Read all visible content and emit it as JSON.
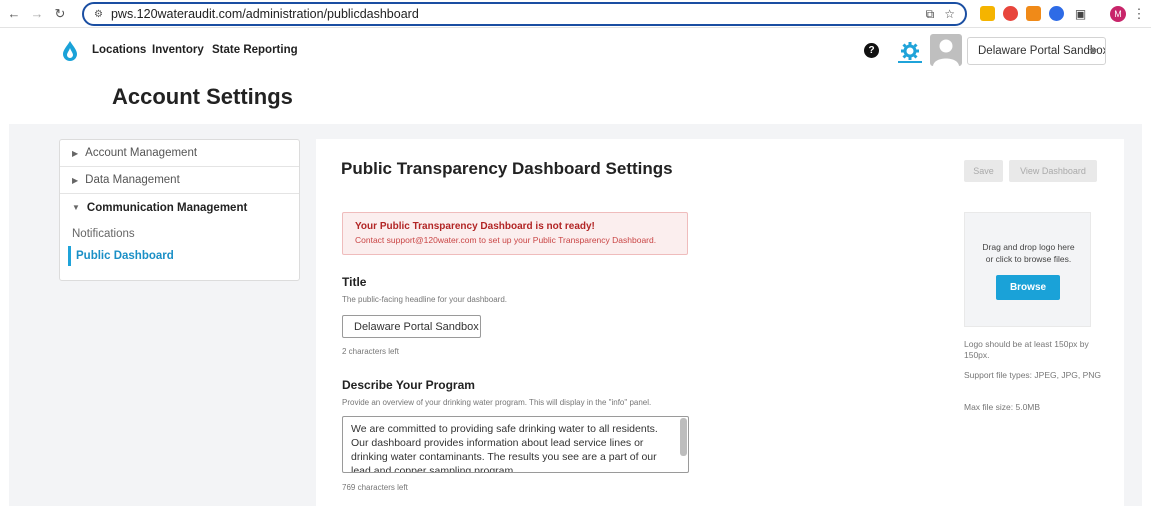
{
  "browser": {
    "url": "pws.120wateraudit.com/administration/publicdashboard",
    "profile_initial": "M"
  },
  "nav": {
    "items": [
      "Locations",
      "Inventory",
      "State Reporting"
    ],
    "help_glyph": "?",
    "portal_select": "Delaware Portal Sandbox"
  },
  "page": {
    "title": "Account Settings"
  },
  "sidebar": {
    "groups": [
      "Account Management",
      "Data Management",
      "Communication Management"
    ],
    "subitems": [
      "Notifications",
      "Public Dashboard"
    ]
  },
  "panel": {
    "title": "Public Transparency Dashboard Settings",
    "save_label": "Save",
    "view_label": "View Dashboard",
    "alert_title": "Your Public Transparency Dashboard is not ready!",
    "alert_body": "Contact support@120water.com to set up your Public Transparency Dashboard.",
    "title_label": "Title",
    "title_help": "The public-facing headline for your dashboard.",
    "title_value": "Delaware Portal Sandbox",
    "title_counter": "2 characters left",
    "desc_label": "Describe Your Program",
    "desc_help": "Provide an overview of your drinking water program. This will display in the \"info\" panel.",
    "desc_value": "We are committed to providing safe drinking water to all residents. Our dashboard provides information about lead service lines or drinking water contaminants. The results you see are a part of our lead and copper sampling program.",
    "desc_counter": "769 characters left"
  },
  "upload": {
    "drop_text_1": "Drag and drop logo here",
    "drop_text_2": "or click to browse files.",
    "browse_label": "Browse",
    "size_note": "Logo should be at least 150px by 150px.",
    "types_note": "Support file types: JPEG, JPG, PNG",
    "max_note": "Max file size: 5.0MB"
  },
  "colors": {
    "accent": "#1aa2d8",
    "alert_text": "#b22525",
    "alert_bg": "#fbeeee"
  }
}
